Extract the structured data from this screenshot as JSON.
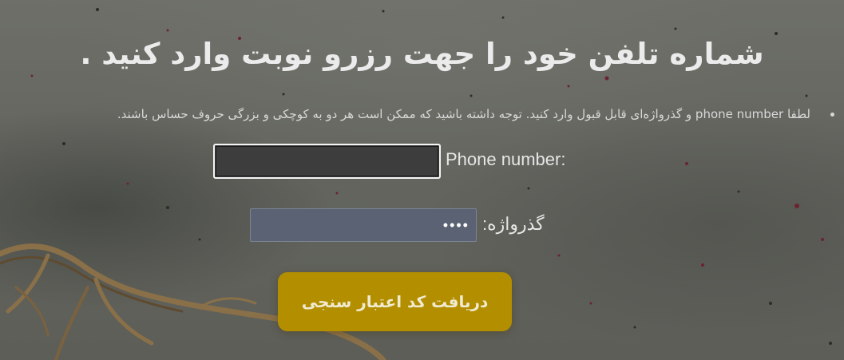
{
  "page": {
    "heading": "شماره تلفن خود را جهت رزرو نوبت وارد کنید .",
    "note": "لطفا phone number و گذرواژه‌ای قابل قبول وارد کنید. توجه داشته باشید که ممکن است هر دو به کوچکی و بزرگی حروف حساس باشند."
  },
  "form": {
    "phone_label": "Phone number:",
    "phone_value": "",
    "password_label": "گذرواژه:",
    "password_value": "••••",
    "submit_label": "دریافت کد اعتبار سنجی"
  },
  "theme": {
    "button_color": "#b38f00",
    "phone_input_bg": "#3d3d3d",
    "password_input_bg": "#5a6273"
  }
}
